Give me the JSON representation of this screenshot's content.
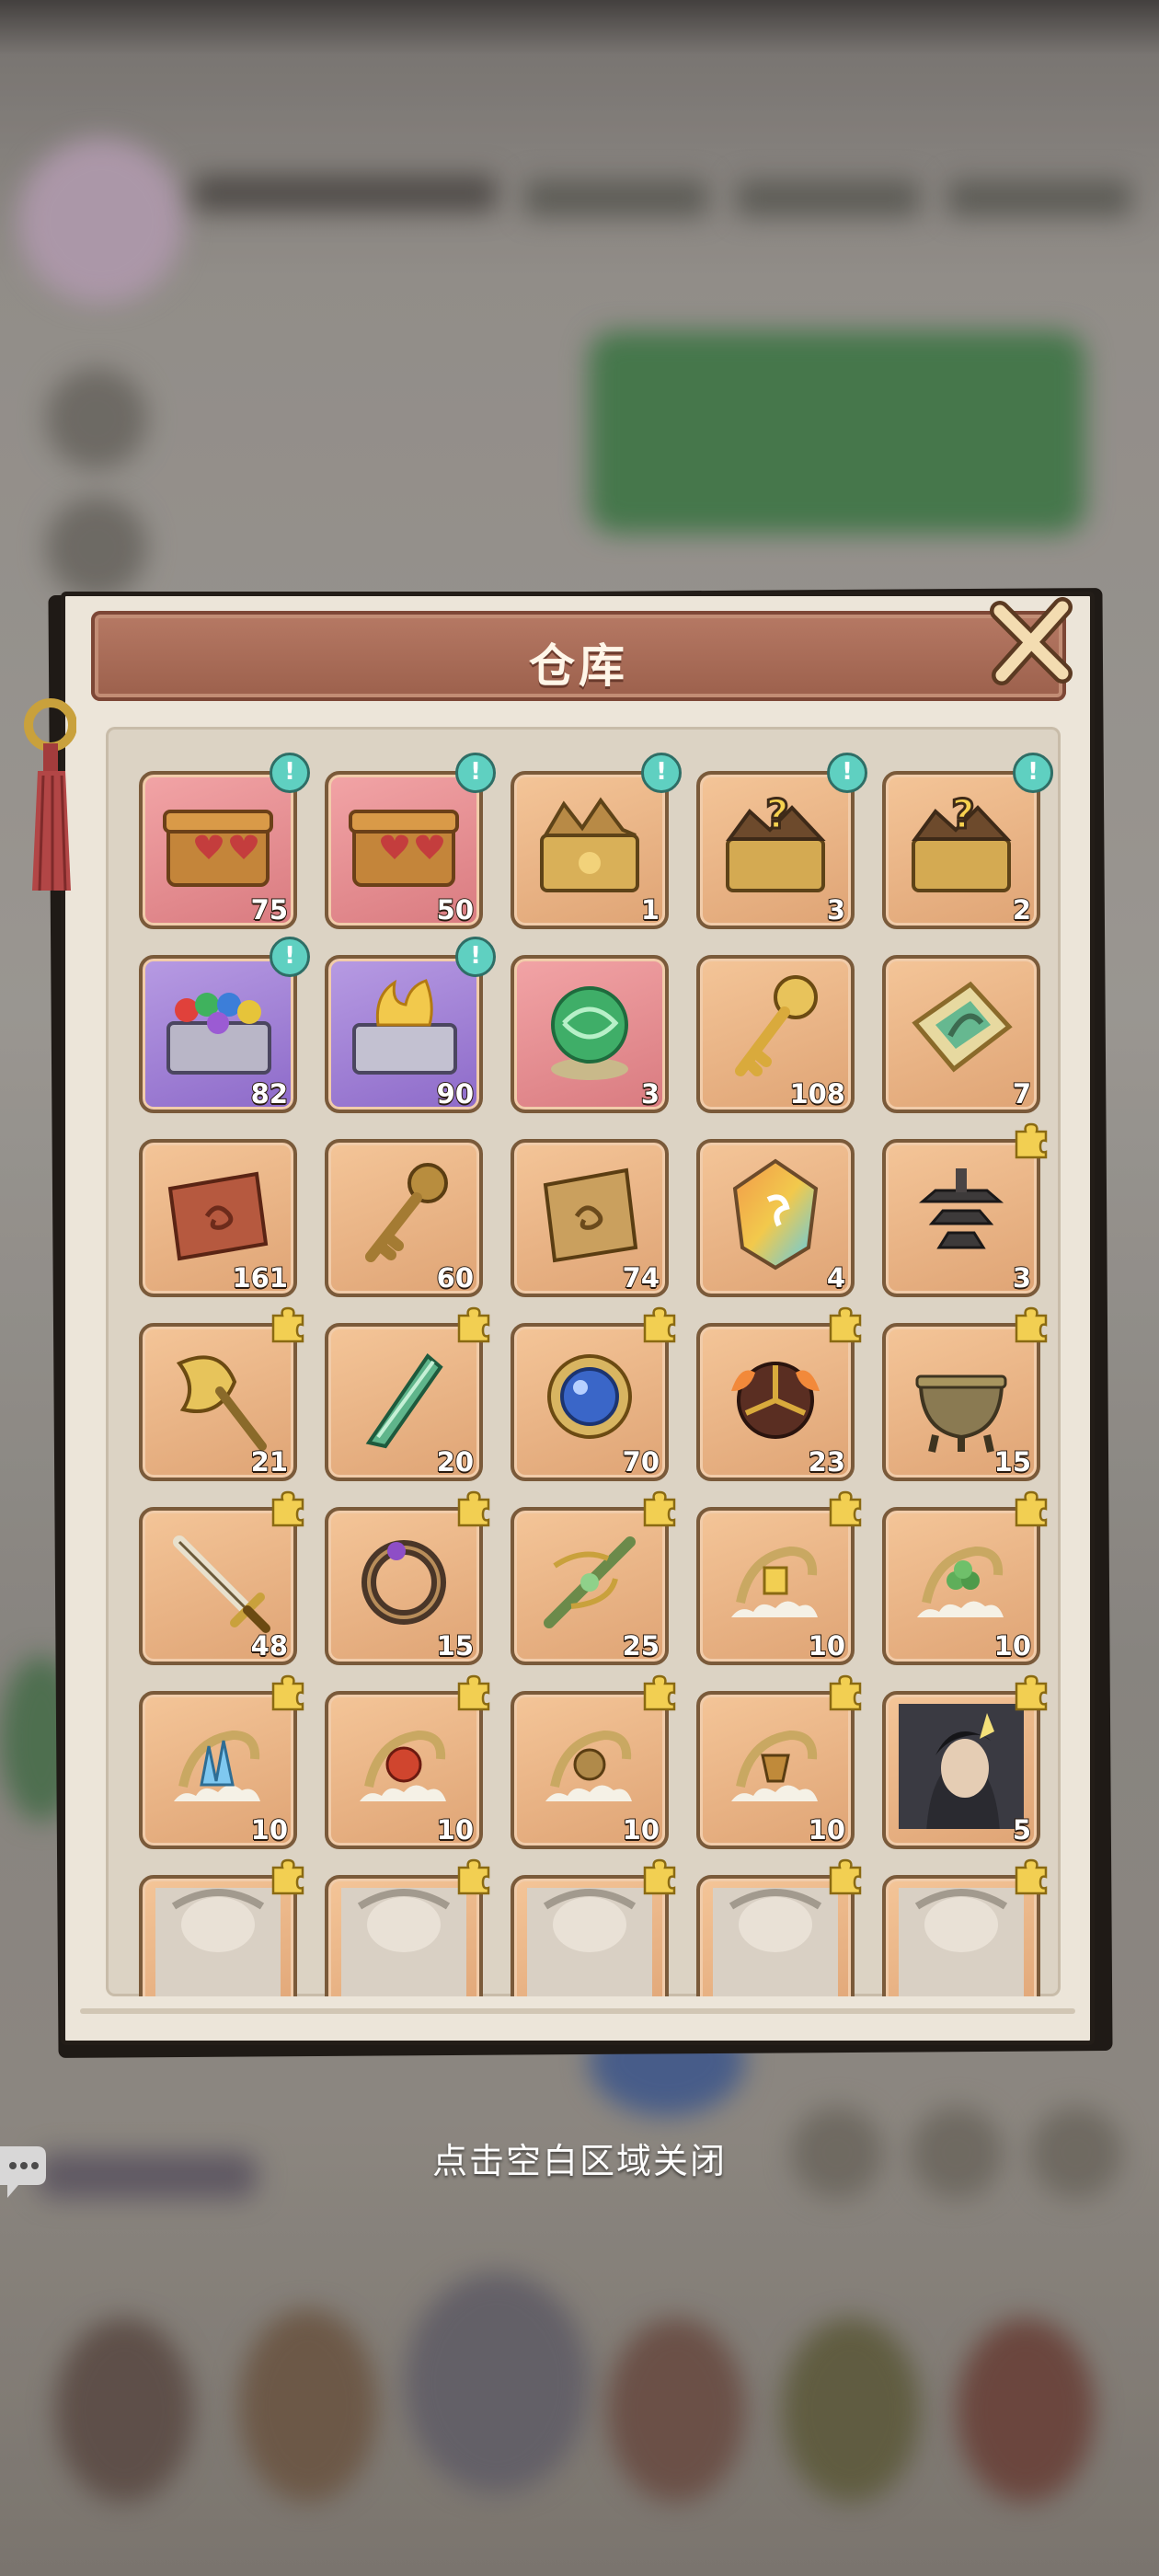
{
  "warehouse": {
    "title": "仓库",
    "close_hint": "点击空白区域关闭",
    "new_badge_glyph": "!",
    "items": [
      {
        "icon": "heart-chest-icon",
        "count": "75",
        "bg": "red",
        "new": true
      },
      {
        "icon": "heart-chest-icon",
        "count": "50",
        "bg": "red",
        "new": true
      },
      {
        "icon": "gold-scroll-chest-icon",
        "count": "1",
        "bg": "orange",
        "new": true
      },
      {
        "icon": "mystery-chest-icon",
        "count": "3",
        "bg": "orange",
        "new": true
      },
      {
        "icon": "mystery-chest-icon",
        "count": "2",
        "bg": "orange",
        "new": true
      },
      {
        "icon": "gem-chest-icon",
        "count": "82",
        "bg": "purple",
        "new": true
      },
      {
        "icon": "flame-chest-icon",
        "count": "90",
        "bg": "purple",
        "new": true
      },
      {
        "icon": "jade-orb-icon",
        "count": "3",
        "bg": "red",
        "new": false
      },
      {
        "icon": "ornate-key-icon",
        "count": "108",
        "bg": "orange",
        "new": false
      },
      {
        "icon": "jade-plaque-icon",
        "count": "7",
        "bg": "orange",
        "new": false
      },
      {
        "icon": "red-scroll-icon",
        "count": "161",
        "bg": "orange",
        "new": false
      },
      {
        "icon": "bronze-key-icon",
        "count": "60",
        "bg": "orange",
        "new": false
      },
      {
        "icon": "gold-scroll-icon",
        "count": "74",
        "bg": "orange",
        "new": false
      },
      {
        "icon": "rainbow-crystal-icon",
        "count": "4",
        "bg": "orange",
        "new": false
      },
      {
        "icon": "pagoda-fragment-icon",
        "count": "3",
        "bg": "orange",
        "new": false,
        "fragment": true
      },
      {
        "icon": "axe-fragment-icon",
        "count": "21",
        "bg": "orange",
        "new": false,
        "fragment": true
      },
      {
        "icon": "jade-blade-fragment-icon",
        "count": "20",
        "bg": "orange",
        "new": false,
        "fragment": true
      },
      {
        "icon": "blue-orb-fragment-icon",
        "count": "70",
        "bg": "orange",
        "new": false,
        "fragment": true
      },
      {
        "icon": "fire-shield-fragment-icon",
        "count": "23",
        "bg": "orange",
        "new": false,
        "fragment": true
      },
      {
        "icon": "bronze-cauldron-fragment-icon",
        "count": "15",
        "bg": "orange",
        "new": false,
        "fragment": true
      },
      {
        "icon": "sword-fragment-icon",
        "count": "48",
        "bg": "orange",
        "new": false,
        "fragment": true
      },
      {
        "icon": "dark-ring-fragment-icon",
        "count": "15",
        "bg": "orange",
        "new": false,
        "fragment": true
      },
      {
        "icon": "green-crossbow-fragment-icon",
        "count": "25",
        "bg": "orange",
        "new": false,
        "fragment": true
      },
      {
        "icon": "dragon-cloud-gold-icon",
        "count": "10",
        "bg": "orange",
        "new": false,
        "fragment": true
      },
      {
        "icon": "dragon-cloud-green-icon",
        "count": "10",
        "bg": "orange",
        "new": false,
        "fragment": true
      },
      {
        "icon": "dragon-cloud-ice-icon",
        "count": "10",
        "bg": "orange",
        "new": false,
        "fragment": true
      },
      {
        "icon": "dragon-cloud-red-icon",
        "count": "10",
        "bg": "orange",
        "new": false,
        "fragment": true
      },
      {
        "icon": "dragon-cloud-bronze-icon",
        "count": "10",
        "bg": "orange",
        "new": false,
        "fragment": true
      },
      {
        "icon": "dragon-cloud-amber-icon",
        "count": "10",
        "bg": "orange",
        "new": false,
        "fragment": true
      },
      {
        "icon": "hero-portrait-icon",
        "count": "5",
        "bg": "orange",
        "new": false,
        "fragment": true
      },
      {
        "icon": "hero-portrait-partial-icon",
        "count": "",
        "bg": "orange",
        "new": false,
        "fragment": true
      },
      {
        "icon": "hero-portrait-partial-icon",
        "count": "",
        "bg": "orange",
        "new": false,
        "fragment": true
      },
      {
        "icon": "hero-portrait-partial-icon",
        "count": "",
        "bg": "orange",
        "new": false,
        "fragment": true
      },
      {
        "icon": "hero-portrait-partial-icon",
        "count": "",
        "bg": "orange",
        "new": false,
        "fragment": true
      },
      {
        "icon": "hero-portrait-partial-icon",
        "count": "",
        "bg": "orange",
        "new": false,
        "fragment": true
      }
    ]
  },
  "colors": {
    "title_bar": "#a8695a",
    "paper": "#ece5d9",
    "frame_orange": "#e9b283",
    "frame_red": "#e3888c",
    "frame_purple": "#9c7bd6",
    "new_badge": "#5fd0c1",
    "fragment_badge": "#f2cf52"
  }
}
